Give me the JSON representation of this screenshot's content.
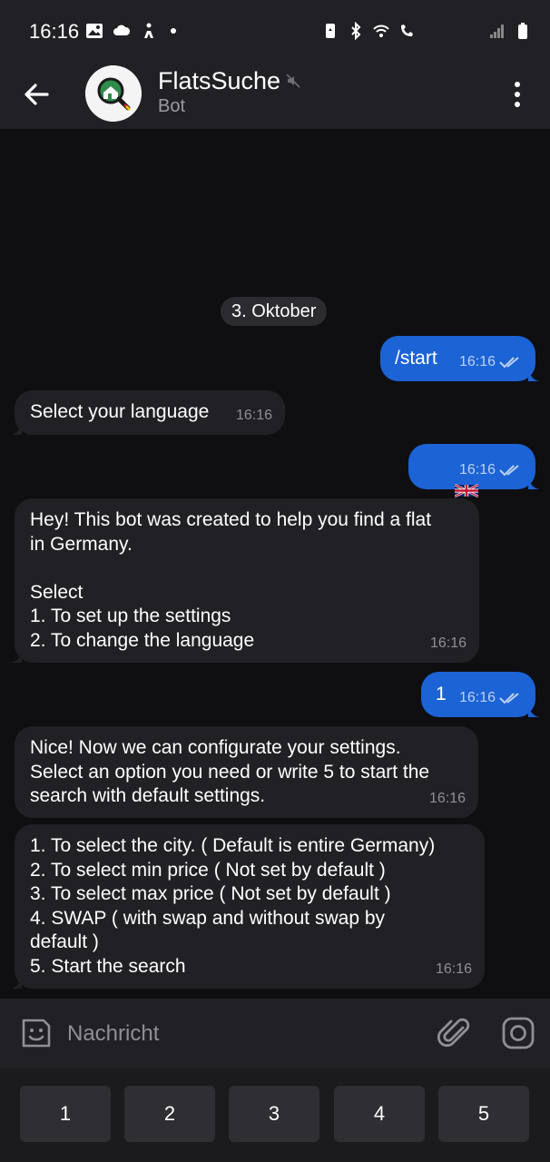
{
  "status_bar": {
    "time": "16:16"
  },
  "header": {
    "title": "FlatsSuche",
    "subtitle": "Bot"
  },
  "chat": {
    "date_label": "3. Oktober",
    "messages": [
      {
        "direction": "out",
        "text": "/start",
        "time": "16:16"
      },
      {
        "direction": "in",
        "text": "Select your language",
        "time": "16:16"
      },
      {
        "direction": "out",
        "text": "🇬🇧",
        "time": "16:16"
      },
      {
        "direction": "in",
        "text": "Hey! This bot was created to help you find a flat\nin Germany.\n\nSelect\n1. To set up the settings\n2. To change the language",
        "time": "16:16"
      },
      {
        "direction": "out",
        "text": "1",
        "time": "16:16"
      },
      {
        "direction": "in",
        "text": "Nice! Now we can configurate your settings.\nSelect an option you need or write 5 to start the\nsearch with default settings.",
        "time": "16:16"
      },
      {
        "direction": "in",
        "text": "1. To select the city. ( Default is entire Germany)\n2. To select min price ( Not set by default )\n3. To select max price ( Not set by default )\n4. SWAP ( with swap and without swap by\ndefault )\n5. Start the search",
        "time": "16:16"
      }
    ]
  },
  "input": {
    "placeholder": "Nachricht"
  },
  "keyboard": {
    "buttons": [
      "1",
      "2",
      "3",
      "4",
      "5"
    ]
  },
  "colors": {
    "background": "#0f0f12",
    "bar": "#212125",
    "incoming_bubble": "#212125",
    "outgoing_bubble": "#1c63d5",
    "secondary_text": "#8f8f96"
  }
}
